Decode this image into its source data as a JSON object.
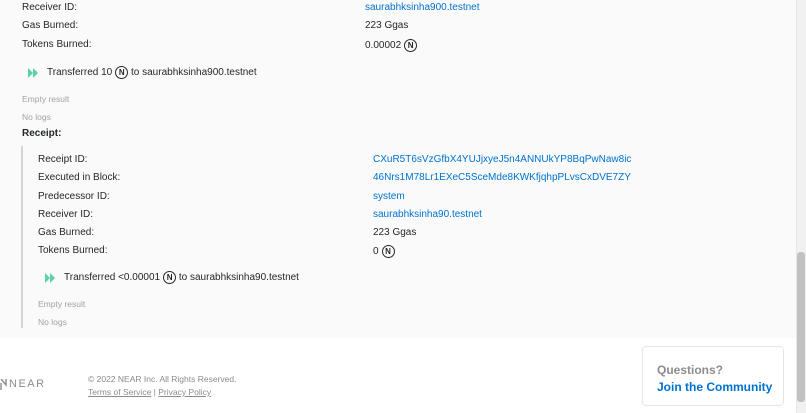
{
  "tx": {
    "receiver_label": "Receiver ID:",
    "receiver_value": "saurabhksinha900.testnet",
    "gas_label": "Gas Burned:",
    "gas_value": "223 Ggas",
    "tokens_label": "Tokens Burned:",
    "tokens_value": "0.00002",
    "transfer_prefix": "Transferred 10",
    "transfer_to": "to",
    "transfer_target": "saurabhksinha900.testnet",
    "result": "Empty result",
    "logs": "No logs"
  },
  "receipt": {
    "heading": "Receipt:",
    "receipt_id_label": "Receipt ID:",
    "receipt_id_value": "CXuR5T6sVzGfbX4YUJjxyeJ5n4ANNUkYP8BqPwNaw8ic",
    "block_label": "Executed in Block:",
    "block_value": "46Nrs1M78Lr1EXeC5SceMde8KWKfjqhpPLvsCxDVE7ZY",
    "predecessor_label": "Predecessor ID:",
    "predecessor_value": "system",
    "receiver_label": "Receiver ID:",
    "receiver_value": "saurabhksinha90.testnet",
    "gas_label": "Gas Burned:",
    "gas_value": "223 Ggas",
    "tokens_label": "Tokens Burned:",
    "tokens_value": "0",
    "transfer_prefix": "Transferred <0.00001",
    "transfer_to": "to",
    "transfer_target": "saurabhksinha90.testnet",
    "result": "Empty result",
    "logs": "No logs"
  },
  "footer": {
    "logo_text": "NEAR",
    "copyright": "© 2022 NEAR Inc. All Rights Reserved.",
    "terms": "Terms of Service",
    "separator": "|",
    "privacy": "Privacy Policy",
    "questions": "Questions?",
    "join": "Join the Community"
  },
  "icons": {
    "near_symbol": "Ⓝ",
    "transfer_icon": "double-play-icon"
  },
  "colors": {
    "link": "#0072ce",
    "transfer_icon": "#5ad1a0",
    "muted": "#a2a2a8"
  }
}
